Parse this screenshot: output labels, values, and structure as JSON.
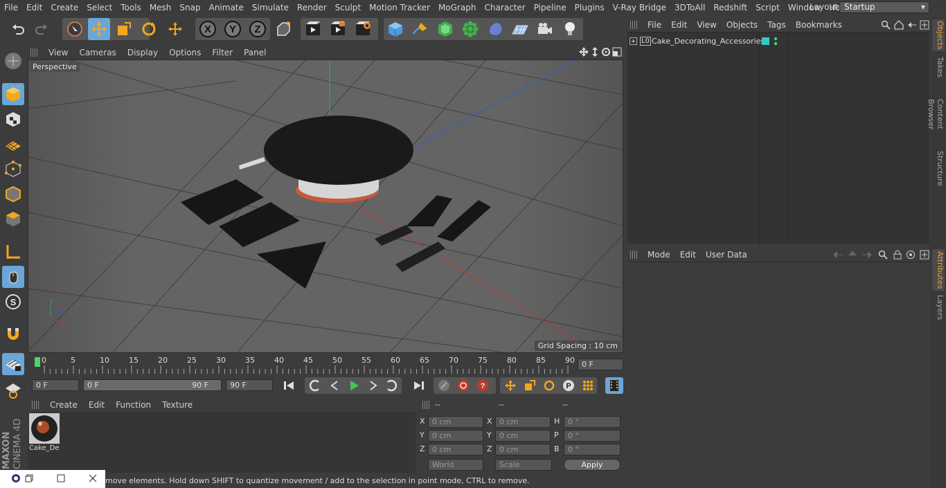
{
  "menu": [
    "File",
    "Edit",
    "Create",
    "Select",
    "Tools",
    "Mesh",
    "Snap",
    "Animate",
    "Simulate",
    "Render",
    "Sculpt",
    "Motion Tracker",
    "MoGraph",
    "Character",
    "Pipeline",
    "Plugins",
    "V-Ray Bridge",
    "3DToAll",
    "Redshift",
    "Script",
    "Window",
    "Help"
  ],
  "layout": {
    "label": "Layout:",
    "value": "Startup"
  },
  "viewport": {
    "menu": [
      "View",
      "Cameras",
      "Display",
      "Options",
      "Filter",
      "Panel"
    ],
    "name": "Perspective",
    "grid_spacing": "Grid Spacing : 10 cm"
  },
  "timeline": {
    "ticks": [
      "0",
      "5",
      "10",
      "15",
      "20",
      "25",
      "30",
      "35",
      "40",
      "45",
      "50",
      "55",
      "60",
      "65",
      "70",
      "75",
      "80",
      "85",
      "90"
    ],
    "current_frame": "0 F"
  },
  "transport": {
    "start": "0 F",
    "range_start": "0 F",
    "range_end": "90 F",
    "end": "90 F"
  },
  "material_manager": {
    "menu": [
      "Create",
      "Edit",
      "Function",
      "Texture"
    ],
    "material_name": "Cake_De"
  },
  "coordinates": {
    "col_headers": [
      "--",
      "--",
      "--"
    ],
    "rows": [
      {
        "a": "X",
        "av": "0 cm",
        "b": "X",
        "bv": "0 cm",
        "c": "H",
        "cv": "0 °"
      },
      {
        "a": "Y",
        "av": "0 cm",
        "b": "Y",
        "bv": "0 cm",
        "c": "P",
        "cv": "0 °"
      },
      {
        "a": "Z",
        "av": "0 cm",
        "b": "Z",
        "bv": "0 cm",
        "c": "B",
        "cv": "0 °"
      }
    ],
    "space": "World",
    "mode": "Scale",
    "apply": "Apply"
  },
  "status": "move elements. Hold down SHIFT to quantize movement / add to the selection in point mode, CTRL to remove.",
  "object_manager": {
    "menu": [
      "File",
      "Edit",
      "View",
      "Objects",
      "Tags",
      "Bookmarks"
    ],
    "objects": [
      {
        "name": "Cake_Decorating_Accessories",
        "layer": "L0"
      }
    ]
  },
  "attributes": {
    "menu": [
      "Mode",
      "Edit",
      "User Data"
    ]
  },
  "side_tabs": [
    "Objects",
    "Takes",
    "Content Browser",
    "Structure",
    "Attributes",
    "Layers"
  ],
  "brand": {
    "maxon": "MAXON",
    "product": "CINEMA 4D"
  },
  "colors": {
    "accent": "#6aa6d8",
    "axis_x": "#c0392b",
    "axis_y": "#27ae60",
    "axis_z": "#2e5bd0",
    "tag": "#35c7c7"
  }
}
